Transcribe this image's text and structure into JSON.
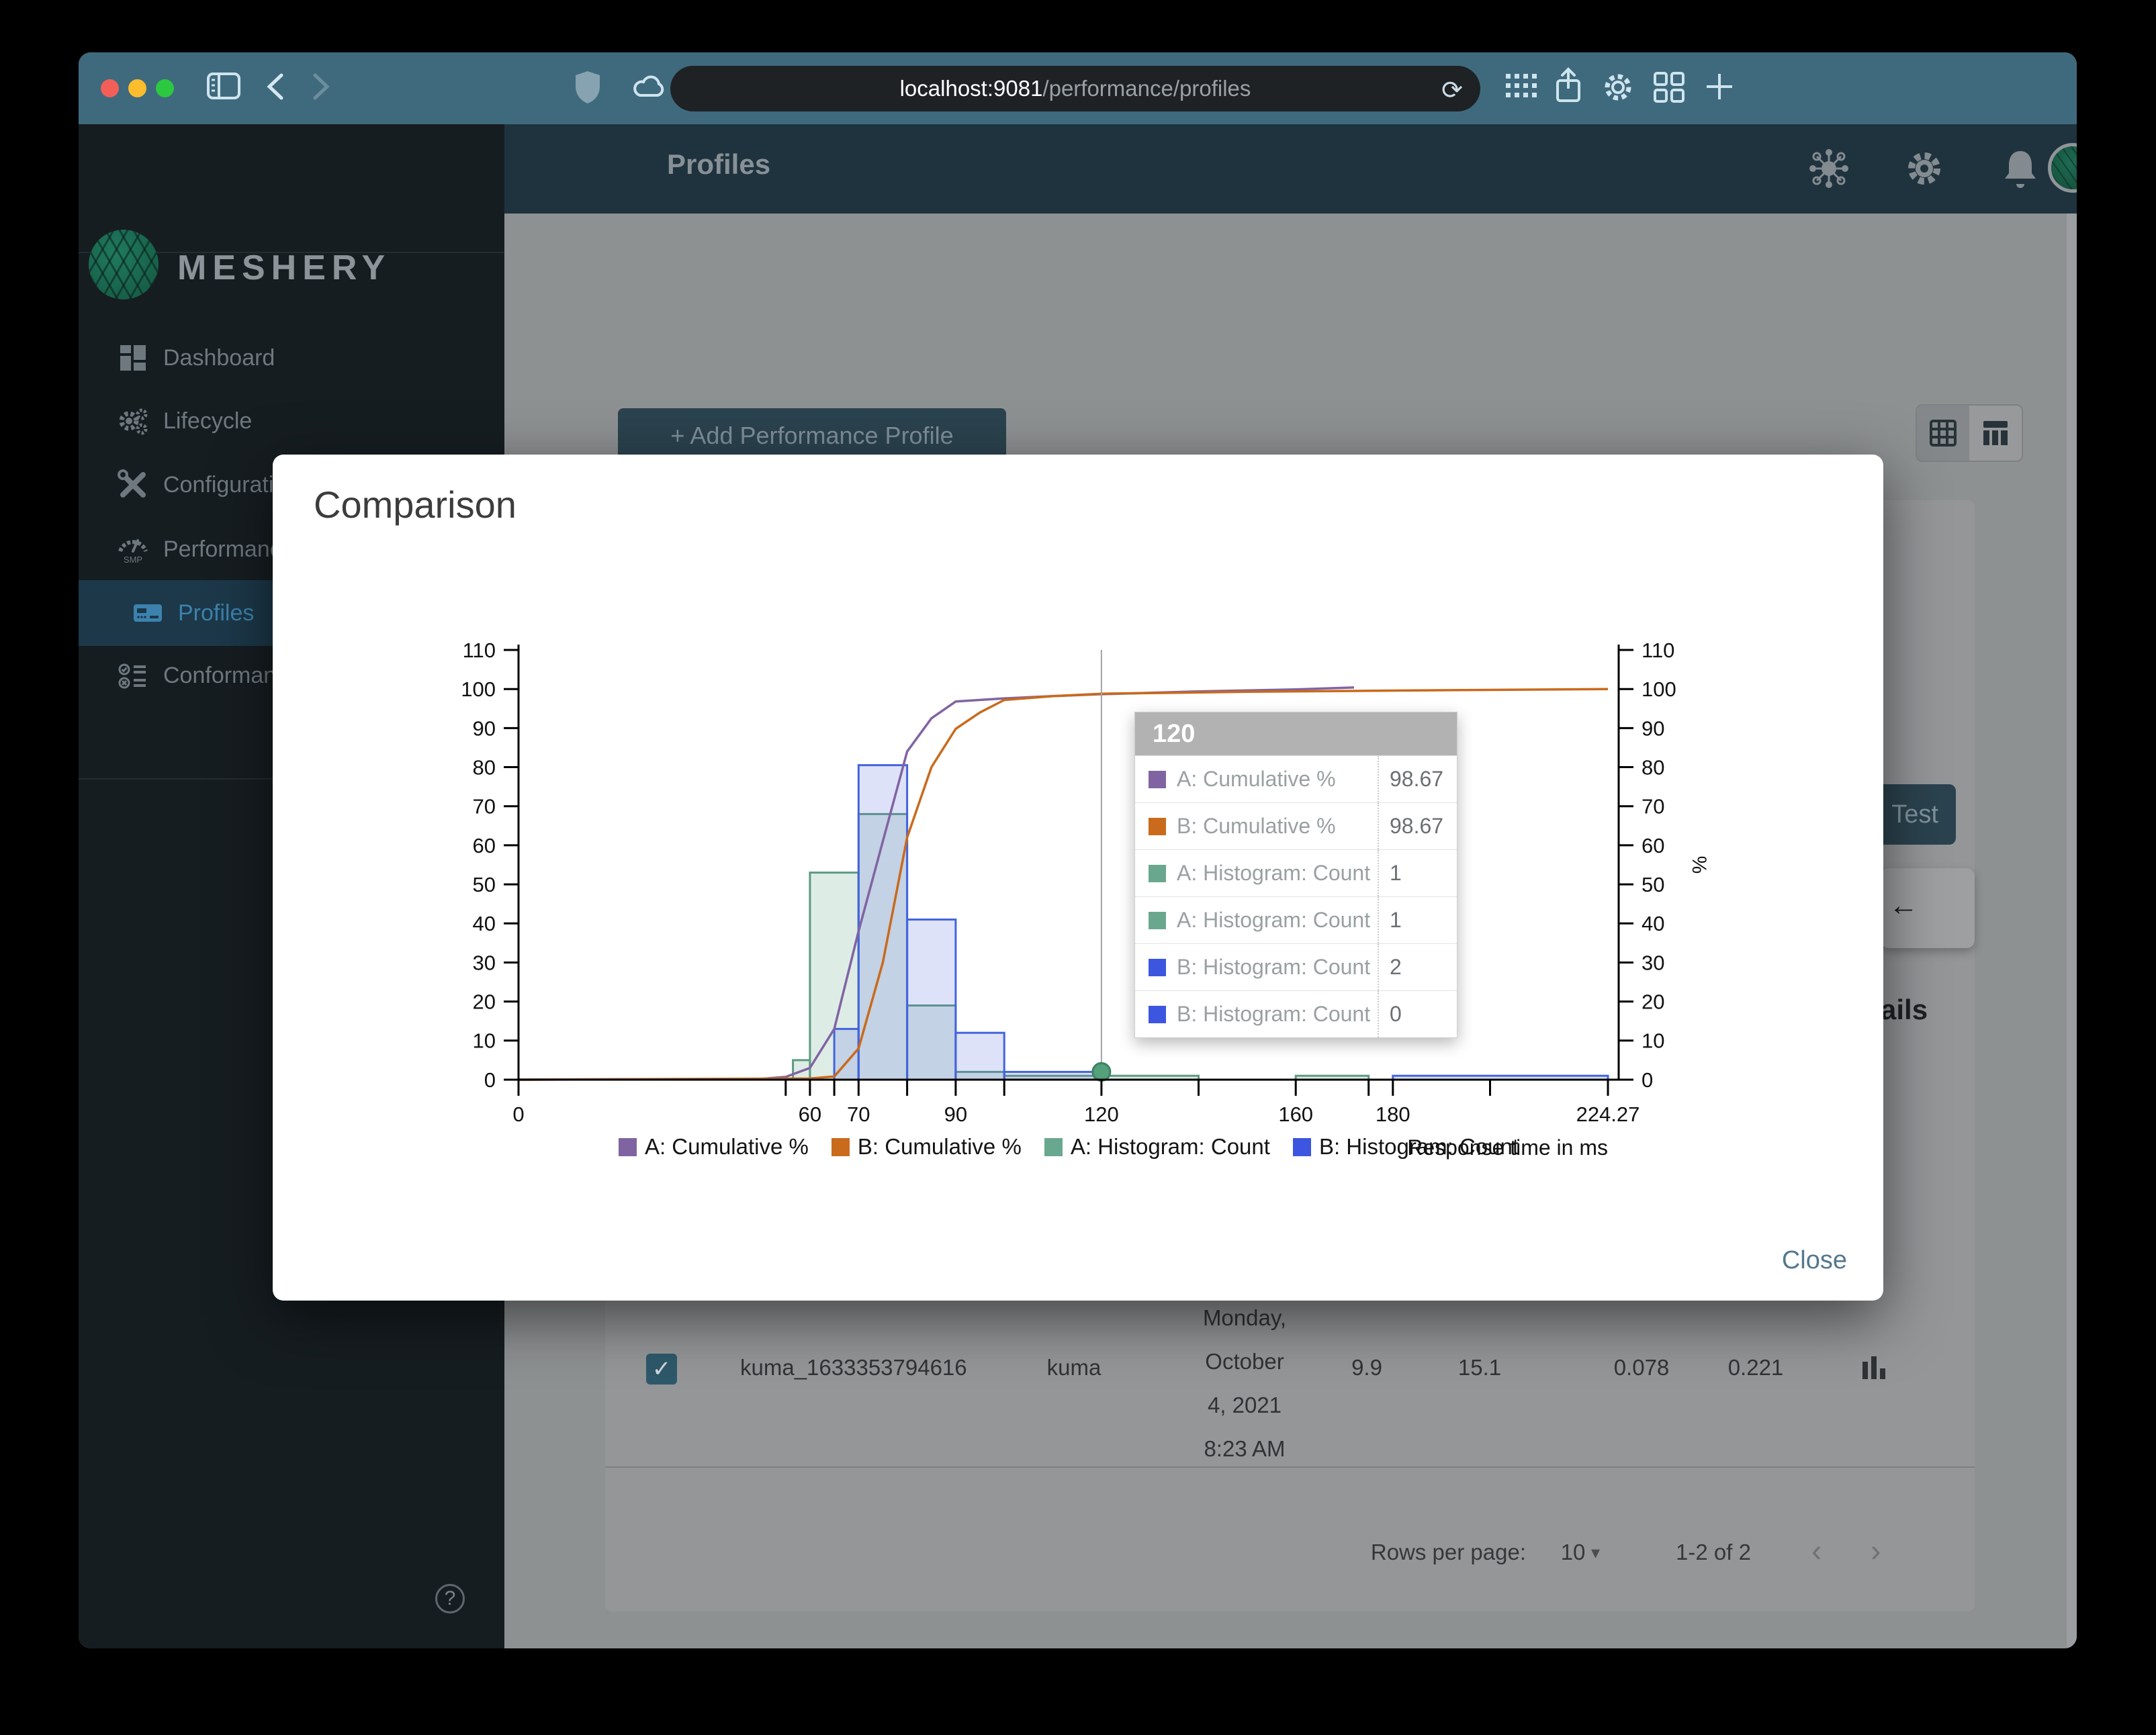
{
  "browser": {
    "url_host": "localhost:9081",
    "url_path": "/performance/profiles"
  },
  "sidebar": {
    "brand": "MESHERY",
    "items": [
      {
        "label": "Dashboard",
        "active": false
      },
      {
        "label": "Lifecycle",
        "active": false
      },
      {
        "label": "Configuration",
        "active": false
      },
      {
        "label": "Performance",
        "active": false
      },
      {
        "label": "Profiles",
        "active": true
      },
      {
        "label": "Conformance",
        "active": false
      }
    ]
  },
  "header": {
    "title": "Profiles"
  },
  "content": {
    "add_profile_button": "+ Add Performance Profile",
    "test_button": "Test",
    "back_arrow": "←",
    "details_fragment": "ails",
    "table_row": {
      "name": "kuma_1633353794616",
      "mesh": "kuma",
      "date_lines": [
        "Monday,",
        "October",
        "4, 2021",
        "8:23 AM"
      ],
      "qps": "9.9",
      "duration": "15.1",
      "p50": "0.078",
      "p99": "0.221"
    },
    "pagination": {
      "label": "Rows per page:",
      "value": "10",
      "caret": "▾",
      "range": "1-2 of 2",
      "prev": "‹",
      "next": "›"
    },
    "checkbox_glyph": "✓"
  },
  "modal": {
    "title": "Comparison",
    "close": "Close"
  },
  "chart_data": {
    "type": "histogram+cumulative-line",
    "xlabel": "Response time in ms",
    "ylabel_right": "%",
    "x_max": 224.27,
    "y_max": 110,
    "y_ticks": [
      0,
      10,
      20,
      30,
      40,
      50,
      60,
      70,
      80,
      90,
      100,
      110
    ],
    "x_ticks_labeled": [
      0,
      60,
      70,
      90,
      120,
      160,
      180,
      224.27
    ],
    "x_ticks_minor": [
      55,
      65,
      80,
      100,
      140,
      175,
      200
    ],
    "grid": false,
    "legend_position": "bottom",
    "series": [
      {
        "name": "A: Cumulative %",
        "type": "line",
        "color": "#8064A2",
        "points": [
          [
            0,
            0
          ],
          [
            50,
            0.2
          ],
          [
            55,
            0.7
          ],
          [
            60,
            3
          ],
          [
            65,
            13
          ],
          [
            70,
            38
          ],
          [
            75,
            61
          ],
          [
            80,
            84
          ],
          [
            85,
            92.5
          ],
          [
            90,
            96.8
          ],
          [
            100,
            97.6
          ],
          [
            110,
            98.2
          ],
          [
            120,
            98.67
          ],
          [
            140,
            99.4
          ],
          [
            160,
            99.9
          ],
          [
            172,
            100.4
          ]
        ]
      },
      {
        "name": "B: Cumulative %",
        "type": "line",
        "color": "#C96A1C",
        "points": [
          [
            0,
            0
          ],
          [
            60,
            0.3
          ],
          [
            65,
            0.8
          ],
          [
            70,
            8
          ],
          [
            75,
            30
          ],
          [
            80,
            62
          ],
          [
            85,
            80
          ],
          [
            90,
            89.8
          ],
          [
            95,
            94
          ],
          [
            100,
            97.2
          ],
          [
            110,
            98.2
          ],
          [
            120,
            98.8
          ],
          [
            150,
            99.3
          ],
          [
            180,
            99.6
          ],
          [
            224.27,
            100
          ]
        ]
      },
      {
        "name": "A: Histogram: Count",
        "type": "bars",
        "color": "#5D9A81",
        "fill": "rgba(105,168,143,0.22)",
        "bins": [
          [
            56.5,
            60,
            5
          ],
          [
            60,
            70,
            53
          ],
          [
            70,
            80,
            68
          ],
          [
            80,
            90,
            19
          ],
          [
            90,
            100,
            2
          ],
          [
            100,
            120,
            1
          ],
          [
            120,
            140,
            1
          ],
          [
            160,
            175,
            1
          ]
        ]
      },
      {
        "name": "B: Histogram: Count",
        "type": "bars",
        "color": "#4464DD",
        "fill": "rgba(88,110,220,0.20)",
        "bins": [
          [
            65,
            70,
            13
          ],
          [
            70,
            80,
            80.5
          ],
          [
            80,
            90,
            41
          ],
          [
            90,
            100,
            12
          ],
          [
            100,
            120,
            2
          ],
          [
            180,
            224.27,
            1
          ]
        ]
      }
    ],
    "legend": [
      {
        "label": "A: Cumulative %",
        "color": "#8064A2"
      },
      {
        "label": "B: Cumulative %",
        "color": "#C96A1C"
      },
      {
        "label": "A: Histogram: Count",
        "color": "#69A88F"
      },
      {
        "label": "B: Histogram: Count",
        "color": "#3D56E0"
      }
    ],
    "hover": {
      "x": 120,
      "dot_y": 2,
      "dot_color": "#53a07b"
    },
    "tooltip": {
      "title": "120",
      "rows": [
        {
          "color": "#8064A2",
          "label": "A: Cumulative %",
          "value": "98.67"
        },
        {
          "color": "#C96A1C",
          "label": "B: Cumulative %",
          "value": "98.67"
        },
        {
          "color": "#69A88F",
          "label": "A: Histogram: Count",
          "value": "1"
        },
        {
          "color": "#69A88F",
          "label": "A: Histogram: Count",
          "value": "1"
        },
        {
          "color": "#3D56E0",
          "label": "B: Histogram: Count",
          "value": "2"
        },
        {
          "color": "#3D56E0",
          "label": "B: Histogram: Count",
          "value": "0"
        }
      ]
    }
  }
}
